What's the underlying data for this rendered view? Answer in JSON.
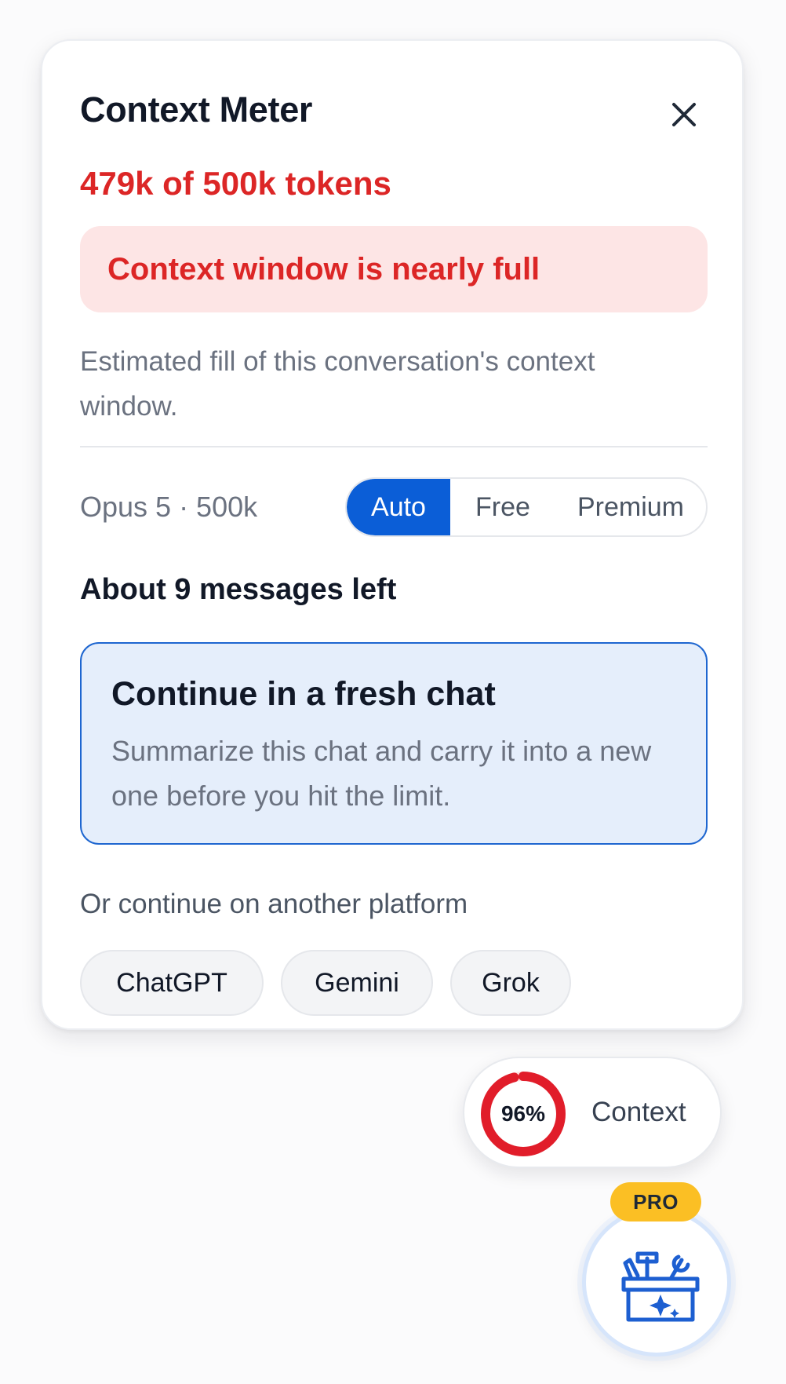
{
  "panel": {
    "title": "Context Meter",
    "close_icon": "close-icon",
    "usage_text": "479k of 500k tokens",
    "alert_text": "Context window is nearly full",
    "description": "Estimated fill of this conversation's context window.",
    "model_label": "Opus 5 · 500k",
    "modes": [
      {
        "label": "Auto",
        "active": true
      },
      {
        "label": "Free",
        "active": false
      },
      {
        "label": "Premium",
        "active": false
      }
    ],
    "messages_left": "About 9 messages left",
    "fresh_chat": {
      "title": "Continue in a fresh chat",
      "subtitle": "Summarize this chat and carry it into a new one before you hit the limit."
    },
    "platform_label": "Or continue on another platform",
    "platforms": [
      "ChatGPT",
      "Gemini",
      "Grok"
    ]
  },
  "context_pill": {
    "percent_value": 96,
    "percent_text": "96%",
    "label": "Context"
  },
  "fab": {
    "badge": "PRO",
    "icon": "toolbox-sparkle-icon"
  },
  "colors": {
    "accent": "#0b5ed7",
    "danger": "#dc2626",
    "danger_bg": "#fde5e5",
    "card_bg": "#e5eefb",
    "badge": "#fbbf24"
  }
}
